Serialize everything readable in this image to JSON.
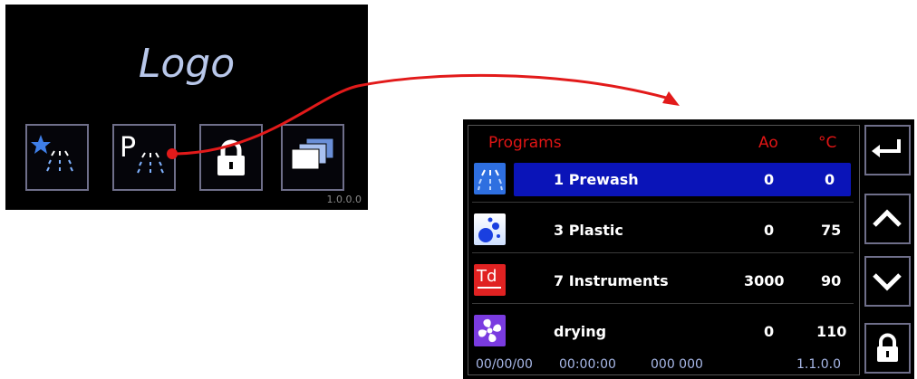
{
  "home": {
    "logo": "Logo",
    "version": "1.0.0.0",
    "tiles": [
      {
        "icon": "star-spray-icon"
      },
      {
        "icon": "program-spray-icon",
        "letter": "P"
      },
      {
        "icon": "lock-icon"
      },
      {
        "icon": "stacked-windows-icon"
      }
    ]
  },
  "program_screen": {
    "header": {
      "title": "Programs",
      "ao": "Ao",
      "temp": "°C"
    },
    "rows": [
      {
        "name": "1 Prewash",
        "ao": "0",
        "temp": "0",
        "icon": "spray-icon",
        "selected": true
      },
      {
        "name": "3 Plastic",
        "ao": "0",
        "temp": "75",
        "icon": "bubbles-icon",
        "selected": false
      },
      {
        "name": "7 Instruments",
        "ao": "3000",
        "temp": "90",
        "icon": "td-icon",
        "icon_text": "Td",
        "selected": false
      },
      {
        "name": "drying",
        "ao": "0",
        "temp": "110",
        "icon": "fan-icon",
        "selected": false
      }
    ],
    "footer": {
      "date": "00/00/00",
      "time": "00:00:00",
      "counter": "000 000",
      "version": "1.1.0.0"
    },
    "side_buttons": [
      "back-arrow-icon",
      "chevron-up-icon",
      "chevron-down-icon",
      "lock-icon"
    ]
  },
  "colors": {
    "accent_red": "#e01515",
    "selection_blue": "#0a14b8",
    "logo_color": "#b8c7ea"
  }
}
